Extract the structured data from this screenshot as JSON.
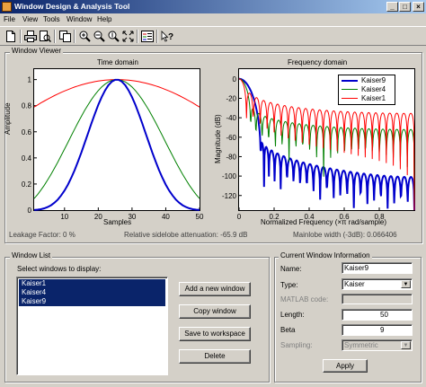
{
  "window": {
    "title": "Window Design & Analysis Tool",
    "min": "_",
    "max": "□",
    "close": "×"
  },
  "menu": [
    "File",
    "View",
    "Tools",
    "Window",
    "Help"
  ],
  "viewer": {
    "group_title": "Window Viewer",
    "time_domain": {
      "title": "Time domain",
      "xlabel": "Samples",
      "ylabel": "Amplitude",
      "xticks": [
        "10",
        "20",
        "30",
        "40",
        "50"
      ],
      "yticks": [
        "0",
        "0.2",
        "0.4",
        "0.6",
        "0.8",
        "1"
      ]
    },
    "freq_domain": {
      "title": "Frequency domain",
      "xlabel": "Normalized Frequency  (×π rad/sample)",
      "ylabel": "Magnitude (dB)",
      "xticks": [
        "0",
        "0.2",
        "0.4",
        "0.6",
        "0.8"
      ],
      "yticks": [
        "0",
        "-20",
        "-40",
        "-60",
        "-80",
        "-100",
        "-120"
      ]
    },
    "legend": [
      "Kaiser9",
      "Kaiser4",
      "Kaiser1"
    ],
    "colors": {
      "Kaiser1": "#ff0000",
      "Kaiser4": "#008000",
      "Kaiser9": "#0000cc"
    },
    "leakage": "Leakage Factor: 0 %",
    "sidelobe": "Relative sidelobe attenuation: -65.9 dB",
    "mainlobe": "Mainlobe width (-3dB): 0.066406"
  },
  "window_list": {
    "group_title": "Window List",
    "select_label": "Select windows to display:",
    "items": [
      "Kaiser1",
      "Kaiser4",
      "Kaiser9"
    ],
    "buttons": {
      "add": "Add a new window",
      "copy": "Copy window",
      "save": "Save to workspace",
      "delete": "Delete"
    }
  },
  "current": {
    "group_title": "Current Window Information",
    "name_label": "Name:",
    "name_value": "Kaiser9",
    "type_label": "Type:",
    "type_value": "Kaiser",
    "matlab_label": "MATLAB code:",
    "matlab_value": "",
    "length_label": "Length:",
    "length_value": "50",
    "beta_label": "Beta",
    "beta_value": "9",
    "sampling_label": "Sampling:",
    "sampling_value": "Symmetric",
    "apply": "Apply"
  }
}
